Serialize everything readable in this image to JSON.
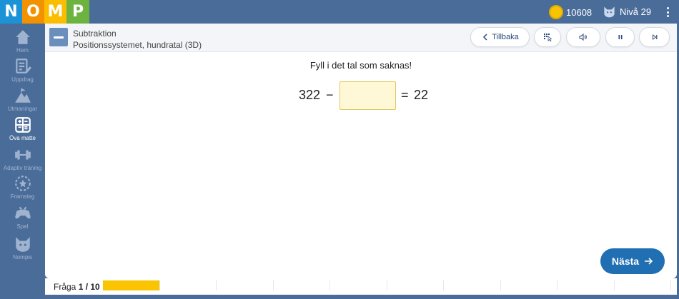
{
  "topbar": {
    "logo_letters": [
      "N",
      "O",
      "M",
      "P"
    ],
    "coins": "10608",
    "level": "Nivå 29"
  },
  "sidebar": {
    "items": [
      {
        "label": "Hem",
        "icon": "home-icon",
        "active": false
      },
      {
        "label": "Uppdrag",
        "icon": "clipboard-pencil-icon",
        "active": false
      },
      {
        "label": "Utmaningar",
        "icon": "mountain-icon",
        "active": false
      },
      {
        "label": "Öva matte",
        "icon": "calculator-icon",
        "active": true
      },
      {
        "label": "Adaptiv träning",
        "icon": "dumbbell-icon",
        "active": false
      },
      {
        "label": "Framsteg",
        "icon": "star-circle-icon",
        "active": false
      },
      {
        "label": "Spel",
        "icon": "gamepad-icon",
        "active": false
      },
      {
        "label": "Nompis",
        "icon": "cat-face-icon",
        "active": false
      }
    ]
  },
  "header": {
    "topic": "Subtraktion",
    "subtopic": "Positionssystemet, hundratal (3D)",
    "back_label": "Tillbaka"
  },
  "exercise": {
    "prompt": "Fyll i det tal som saknas!",
    "left_operand": "322",
    "operator": "−",
    "equals": "=",
    "result": "22",
    "answer_value": ""
  },
  "next_label": "Nästa",
  "progress": {
    "label_prefix": "Fråga",
    "current": "1 / 10",
    "answered_fraction": 0.1,
    "segments": 10
  },
  "colors": {
    "brand_blue": "#4a6c99",
    "accent_button": "#1f6fb2",
    "progress_fill": "#fbc400",
    "input_fill": "#fff8d6"
  }
}
